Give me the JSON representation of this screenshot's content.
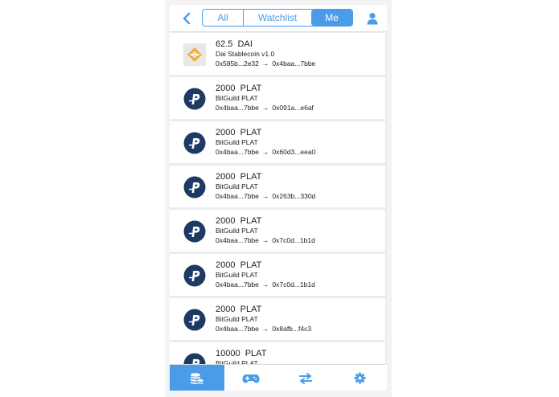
{
  "header": {
    "tabs": [
      {
        "label": "All",
        "active": false
      },
      {
        "label": "Watchlist",
        "active": false
      },
      {
        "label": "Me",
        "active": true
      }
    ],
    "back_icon": "chevron-left-icon",
    "user_icon": "user-icon"
  },
  "transactions": [
    {
      "amount": "62.5",
      "symbol": "DAI",
      "name": "Dai Stablecoin v1.0",
      "from": "0x585b...2e32",
      "to": "0x4baa...7bbe",
      "token": "dai"
    },
    {
      "amount": "2000",
      "symbol": "PLAT",
      "name": "BitGuild PLAT",
      "from": "0x4baa...7bbe",
      "to": "0x091a...e6af",
      "token": "plat"
    },
    {
      "amount": "2000",
      "symbol": "PLAT",
      "name": "BitGuild PLAT",
      "from": "0x4baa...7bbe",
      "to": "0x60d3...eea0",
      "token": "plat"
    },
    {
      "amount": "2000",
      "symbol": "PLAT",
      "name": "BitGuild PLAT",
      "from": "0x4baa...7bbe",
      "to": "0x263b...330d",
      "token": "plat"
    },
    {
      "amount": "2000",
      "symbol": "PLAT",
      "name": "BitGuild PLAT",
      "from": "0x4baa...7bbe",
      "to": "0x7c0d...1b1d",
      "token": "plat"
    },
    {
      "amount": "2000",
      "symbol": "PLAT",
      "name": "BitGuild PLAT",
      "from": "0x4baa...7bbe",
      "to": "0x7c0d...1b1d",
      "token": "plat"
    },
    {
      "amount": "2000",
      "symbol": "PLAT",
      "name": "BitGuild PLAT",
      "from": "0x4baa...7bbe",
      "to": "0x8afb...f4c3",
      "token": "plat"
    },
    {
      "amount": "10000",
      "symbol": "PLAT",
      "name": "BitGuild PLAT",
      "from": "",
      "to": "",
      "token": "plat"
    }
  ],
  "arrow": "→",
  "bottom_nav": [
    {
      "icon": "coins-icon",
      "active": true
    },
    {
      "icon": "gamepad-icon",
      "active": false
    },
    {
      "icon": "transfer-arrows-icon",
      "active": false
    },
    {
      "icon": "gear-icon",
      "active": false
    }
  ],
  "colors": {
    "accent": "#4a9be8",
    "plat_navy": "#1d3a64",
    "dai_orange": "#f5ac37"
  }
}
